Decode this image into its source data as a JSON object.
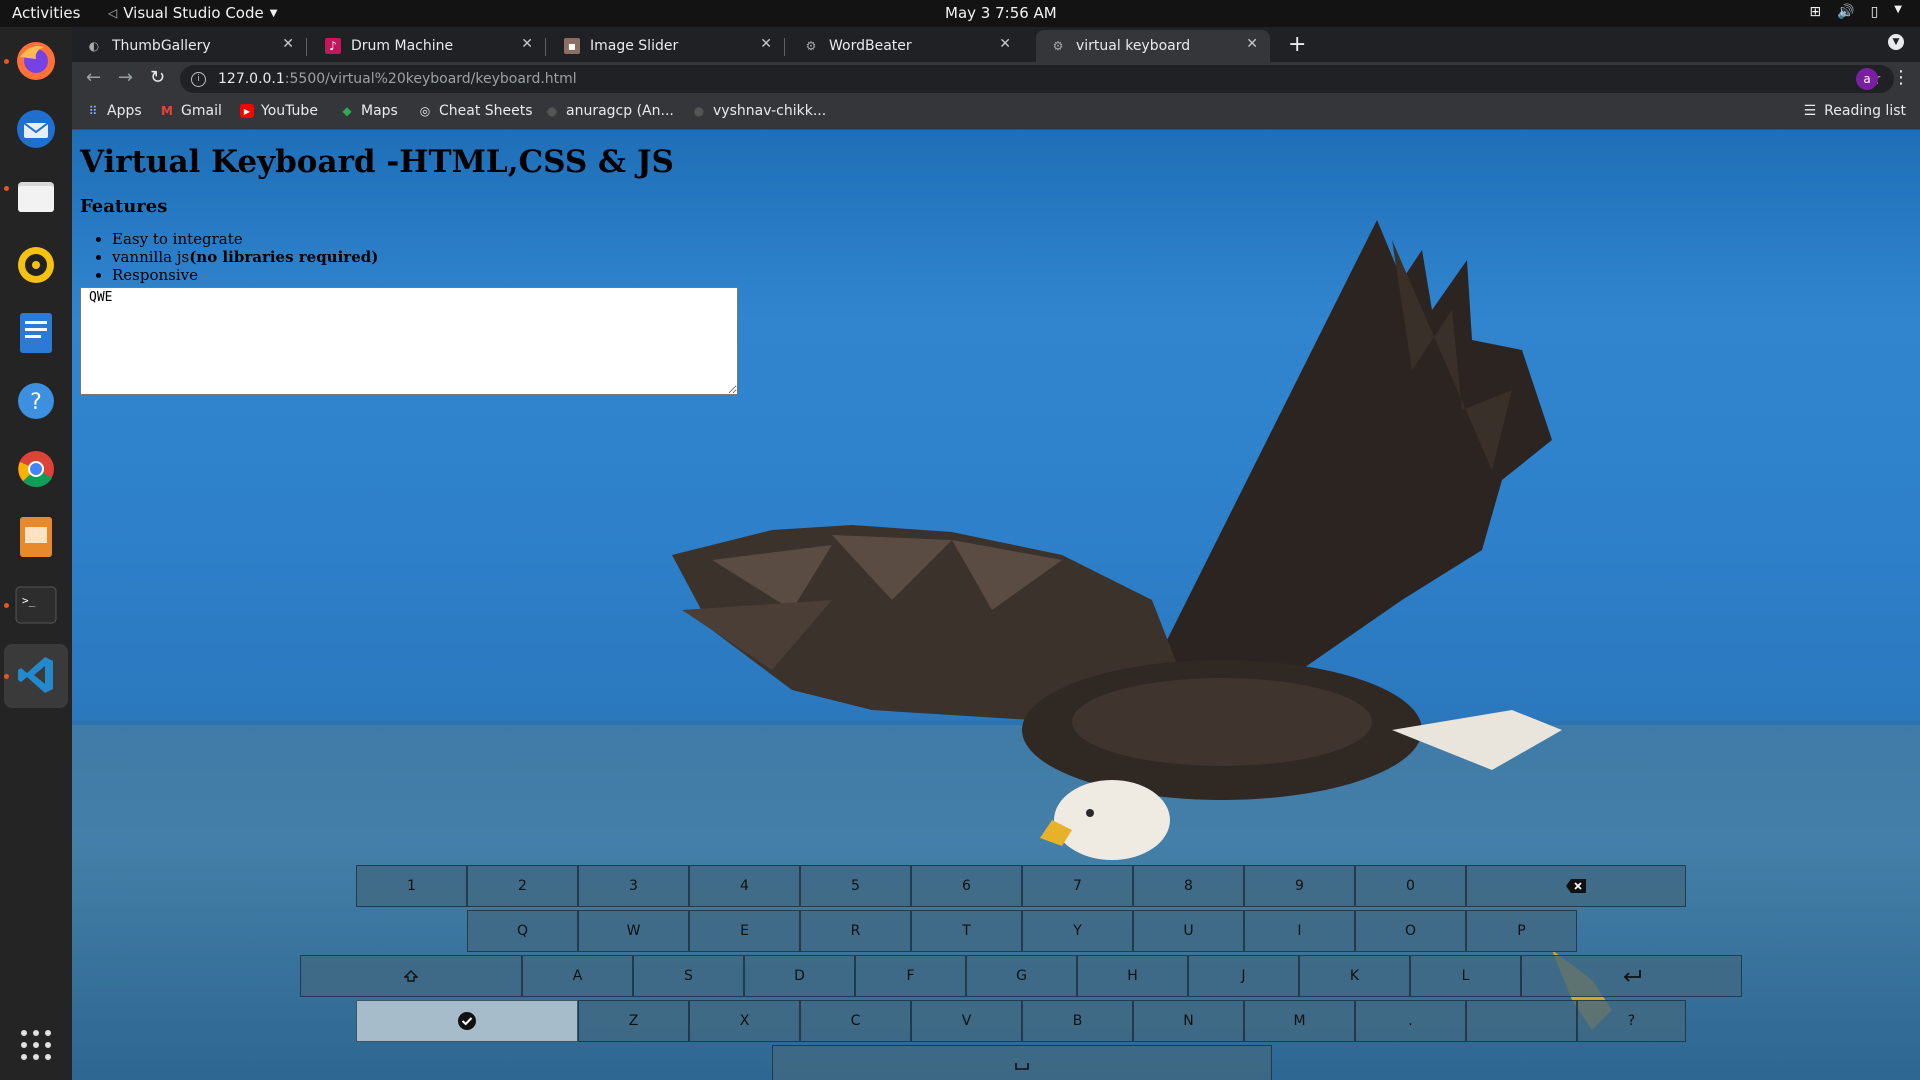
{
  "topbar": {
    "activities": "Activities",
    "app_name": "Visual Studio Code",
    "clock": "May 3  7:56 AM"
  },
  "dock": {
    "items": [
      "firefox-icon",
      "thunderbird-icon",
      "files-icon",
      "rhythmbox-icon",
      "writer-icon",
      "help-icon",
      "chrome-icon",
      "impress-icon",
      "terminal-icon",
      "vscode-icon",
      "apps-grid-icon"
    ]
  },
  "browser": {
    "tabs": [
      {
        "label": "ThumbGallery"
      },
      {
        "label": "Drum Machine"
      },
      {
        "label": "Image Slider"
      },
      {
        "label": "WordBeater"
      },
      {
        "label": "virtual keyboard"
      }
    ],
    "url_host": "127.0.0.1",
    "url_path": ":5500/virtual%20keyboard/keyboard.html",
    "avatar_letter": "a",
    "bookmarks": [
      {
        "label": "Apps"
      },
      {
        "label": "Gmail"
      },
      {
        "label": "YouTube"
      },
      {
        "label": "Maps"
      },
      {
        "label": "Cheat Sheets"
      },
      {
        "label": "anuragcp (An..."
      },
      {
        "label": "vyshnav-chikk..."
      }
    ],
    "reading_list": "Reading list"
  },
  "page": {
    "title": "Virtual Keyboard -HTML,CSS & JS",
    "features_heading": "Features",
    "features": {
      "item1": "Easy to integrate",
      "item2_plain": "vannilla js",
      "item2_bold": "(no libraries required)",
      "item3": "Responsive"
    },
    "textarea_value": "QWE"
  },
  "keyboard": {
    "row1": [
      "1",
      "2",
      "3",
      "4",
      "5",
      "6",
      "7",
      "8",
      "9",
      "0"
    ],
    "row2": [
      "Q",
      "W",
      "E",
      "R",
      "T",
      "Y",
      "U",
      "I",
      "O",
      "P"
    ],
    "row3": [
      "A",
      "S",
      "D",
      "F",
      "G",
      "H",
      "J",
      "K",
      "L"
    ],
    "row4": [
      "Z",
      "X",
      "C",
      "V",
      "B",
      "N",
      "M",
      ".",
      "",
      "?"
    ],
    "icons": {
      "backspace": "backspace-icon",
      "caps": "caps-lock-icon",
      "enter": "enter-icon",
      "done": "check-circle-icon",
      "space": "space-bar-icon"
    },
    "colors": {
      "key": "#41698a",
      "done_key": "#a7bccb"
    }
  }
}
